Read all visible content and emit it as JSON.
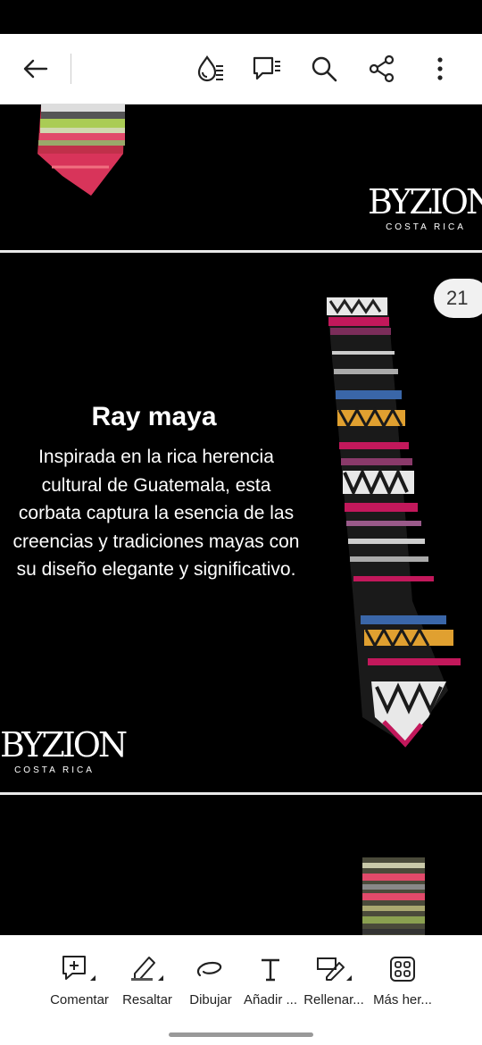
{
  "topbar": {
    "back_icon": "arrow-left-icon",
    "icons": [
      "reading-mode-icon",
      "comments-icon",
      "search-icon",
      "share-icon",
      "more-vertical-icon"
    ]
  },
  "page_number": "21",
  "slide": {
    "title": "Ray maya",
    "body_lines": [
      "Inspirada en la rica herencia",
      "cultural de Guatemala, esta",
      "corbata captura la esencia de las",
      "creencias y tradiciones mayas con",
      "su diseño elegante y significativo."
    ]
  },
  "brand": {
    "logo": "BYZION",
    "sub": "COSTA RICA"
  },
  "toolbar": {
    "comment": "Comentar",
    "highlight": "Resaltar",
    "draw": "Dibujar",
    "add_text": "Añadir ...",
    "fill_sign": "Rellenar...",
    "more_tools": "Más her..."
  }
}
